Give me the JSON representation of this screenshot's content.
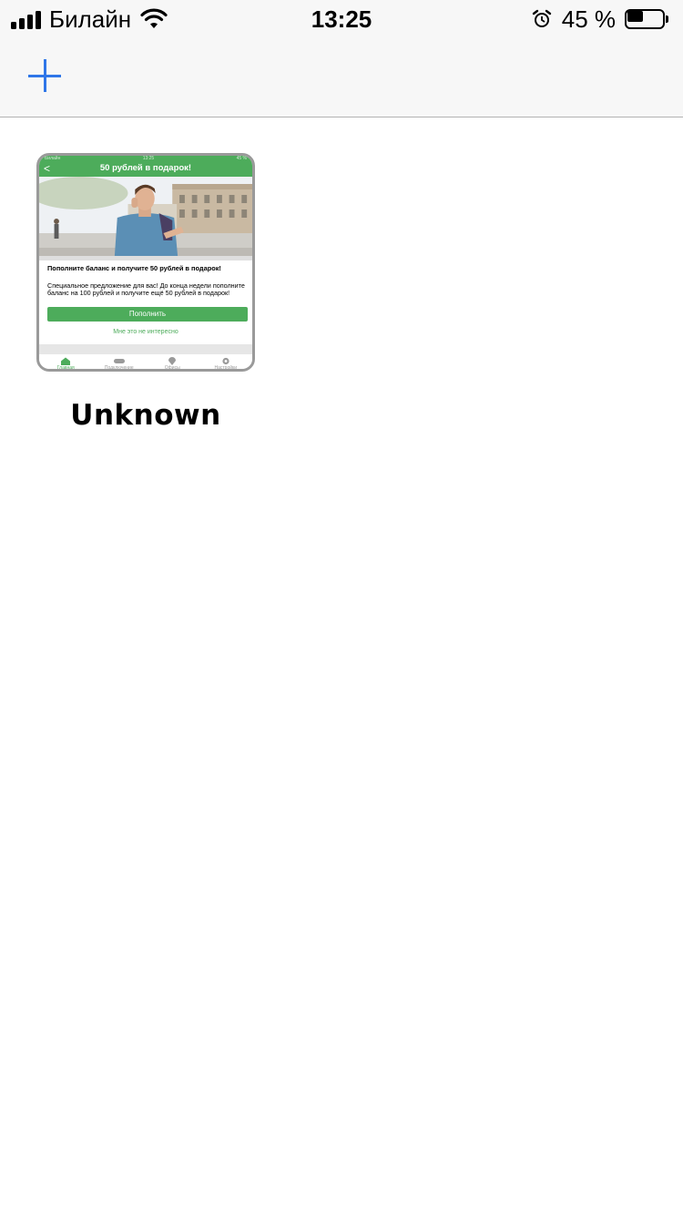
{
  "status_bar": {
    "carrier": "Билайн",
    "time": "13:25",
    "battery": "45 %",
    "battery_level": 0.45,
    "icons": [
      "signal-icon",
      "wifi-icon",
      "alarm-icon",
      "battery-icon"
    ]
  },
  "nav_bar": {
    "add_icon": "plus-icon",
    "accent_color": "#2f76e8"
  },
  "items": [
    {
      "label": "Unknown",
      "thumbnail": {
        "status_left": "Билайн",
        "status_time": "13:25",
        "status_right": "45 %",
        "title": "50 рублей в подарок!",
        "heading": "Пополните баланс и получите 50 рублей в подарок!",
        "body": "Специальное предложение для вас! До конца недели пополните баланс на 100 рублей и получите ещё 50 рублей в подарок!",
        "button": "Пополнить",
        "link": "Мне это не интересно",
        "tabs": [
          "Главная",
          "Подключение",
          "Офисы",
          "Настройки"
        ],
        "active_tab": 0,
        "accent_color": "#4dac5b"
      }
    }
  ]
}
